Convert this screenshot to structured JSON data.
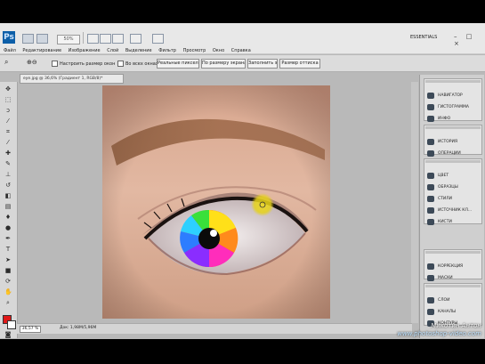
{
  "app": {
    "logo": "Ps",
    "zoom_menu": "50%",
    "workspace": "ESSENTIALS",
    "window_controls": "– □ ×",
    "menus": [
      "Файл",
      "Редактирование",
      "Изображение",
      "Слой",
      "Выделение",
      "Фильтр",
      "Просмотр",
      "Окно",
      "Справка"
    ]
  },
  "options_bar": {
    "resize_windows": "Настроить размер окон",
    "all_windows": "Во всех окнах",
    "actual_pixels": "Реальные пикселы",
    "fit_screen": "По размеру экрана",
    "fill_screen": "Заполнить экран",
    "print_size": "Размер оттиска"
  },
  "document": {
    "tab": "eye.jpg @ 36,6% (Градиент 1, RGB/8)*",
    "zoom": "36,57 %",
    "size": "Док: 1,98M/5,96M"
  },
  "panels": {
    "group1": [
      "НАВИГАТОР",
      "ГИСТОГРАММА",
      "ИНФО"
    ],
    "group2": [
      "ИСТОРИЯ",
      "ОПЕРАЦИИ"
    ],
    "group3": [
      "ЦВЕТ",
      "ОБРАЗЦЫ",
      "СТИЛИ",
      "ИСТОЧНИК КЛ...",
      "КИСТИ"
    ],
    "group4": [
      "КОРРЕКЦИЯ",
      "МАСКИ"
    ],
    "group5": [
      "СЛОИ",
      "КАНАЛЫ",
      "КОНТУРЫ"
    ]
  },
  "watermark": {
    "author": "Микотин Антон",
    "url": "www.photoshop-video.com"
  },
  "colors": {
    "foreground": "#e01818",
    "background": "#ffffff",
    "highlight_spot": "#e6d21a"
  }
}
